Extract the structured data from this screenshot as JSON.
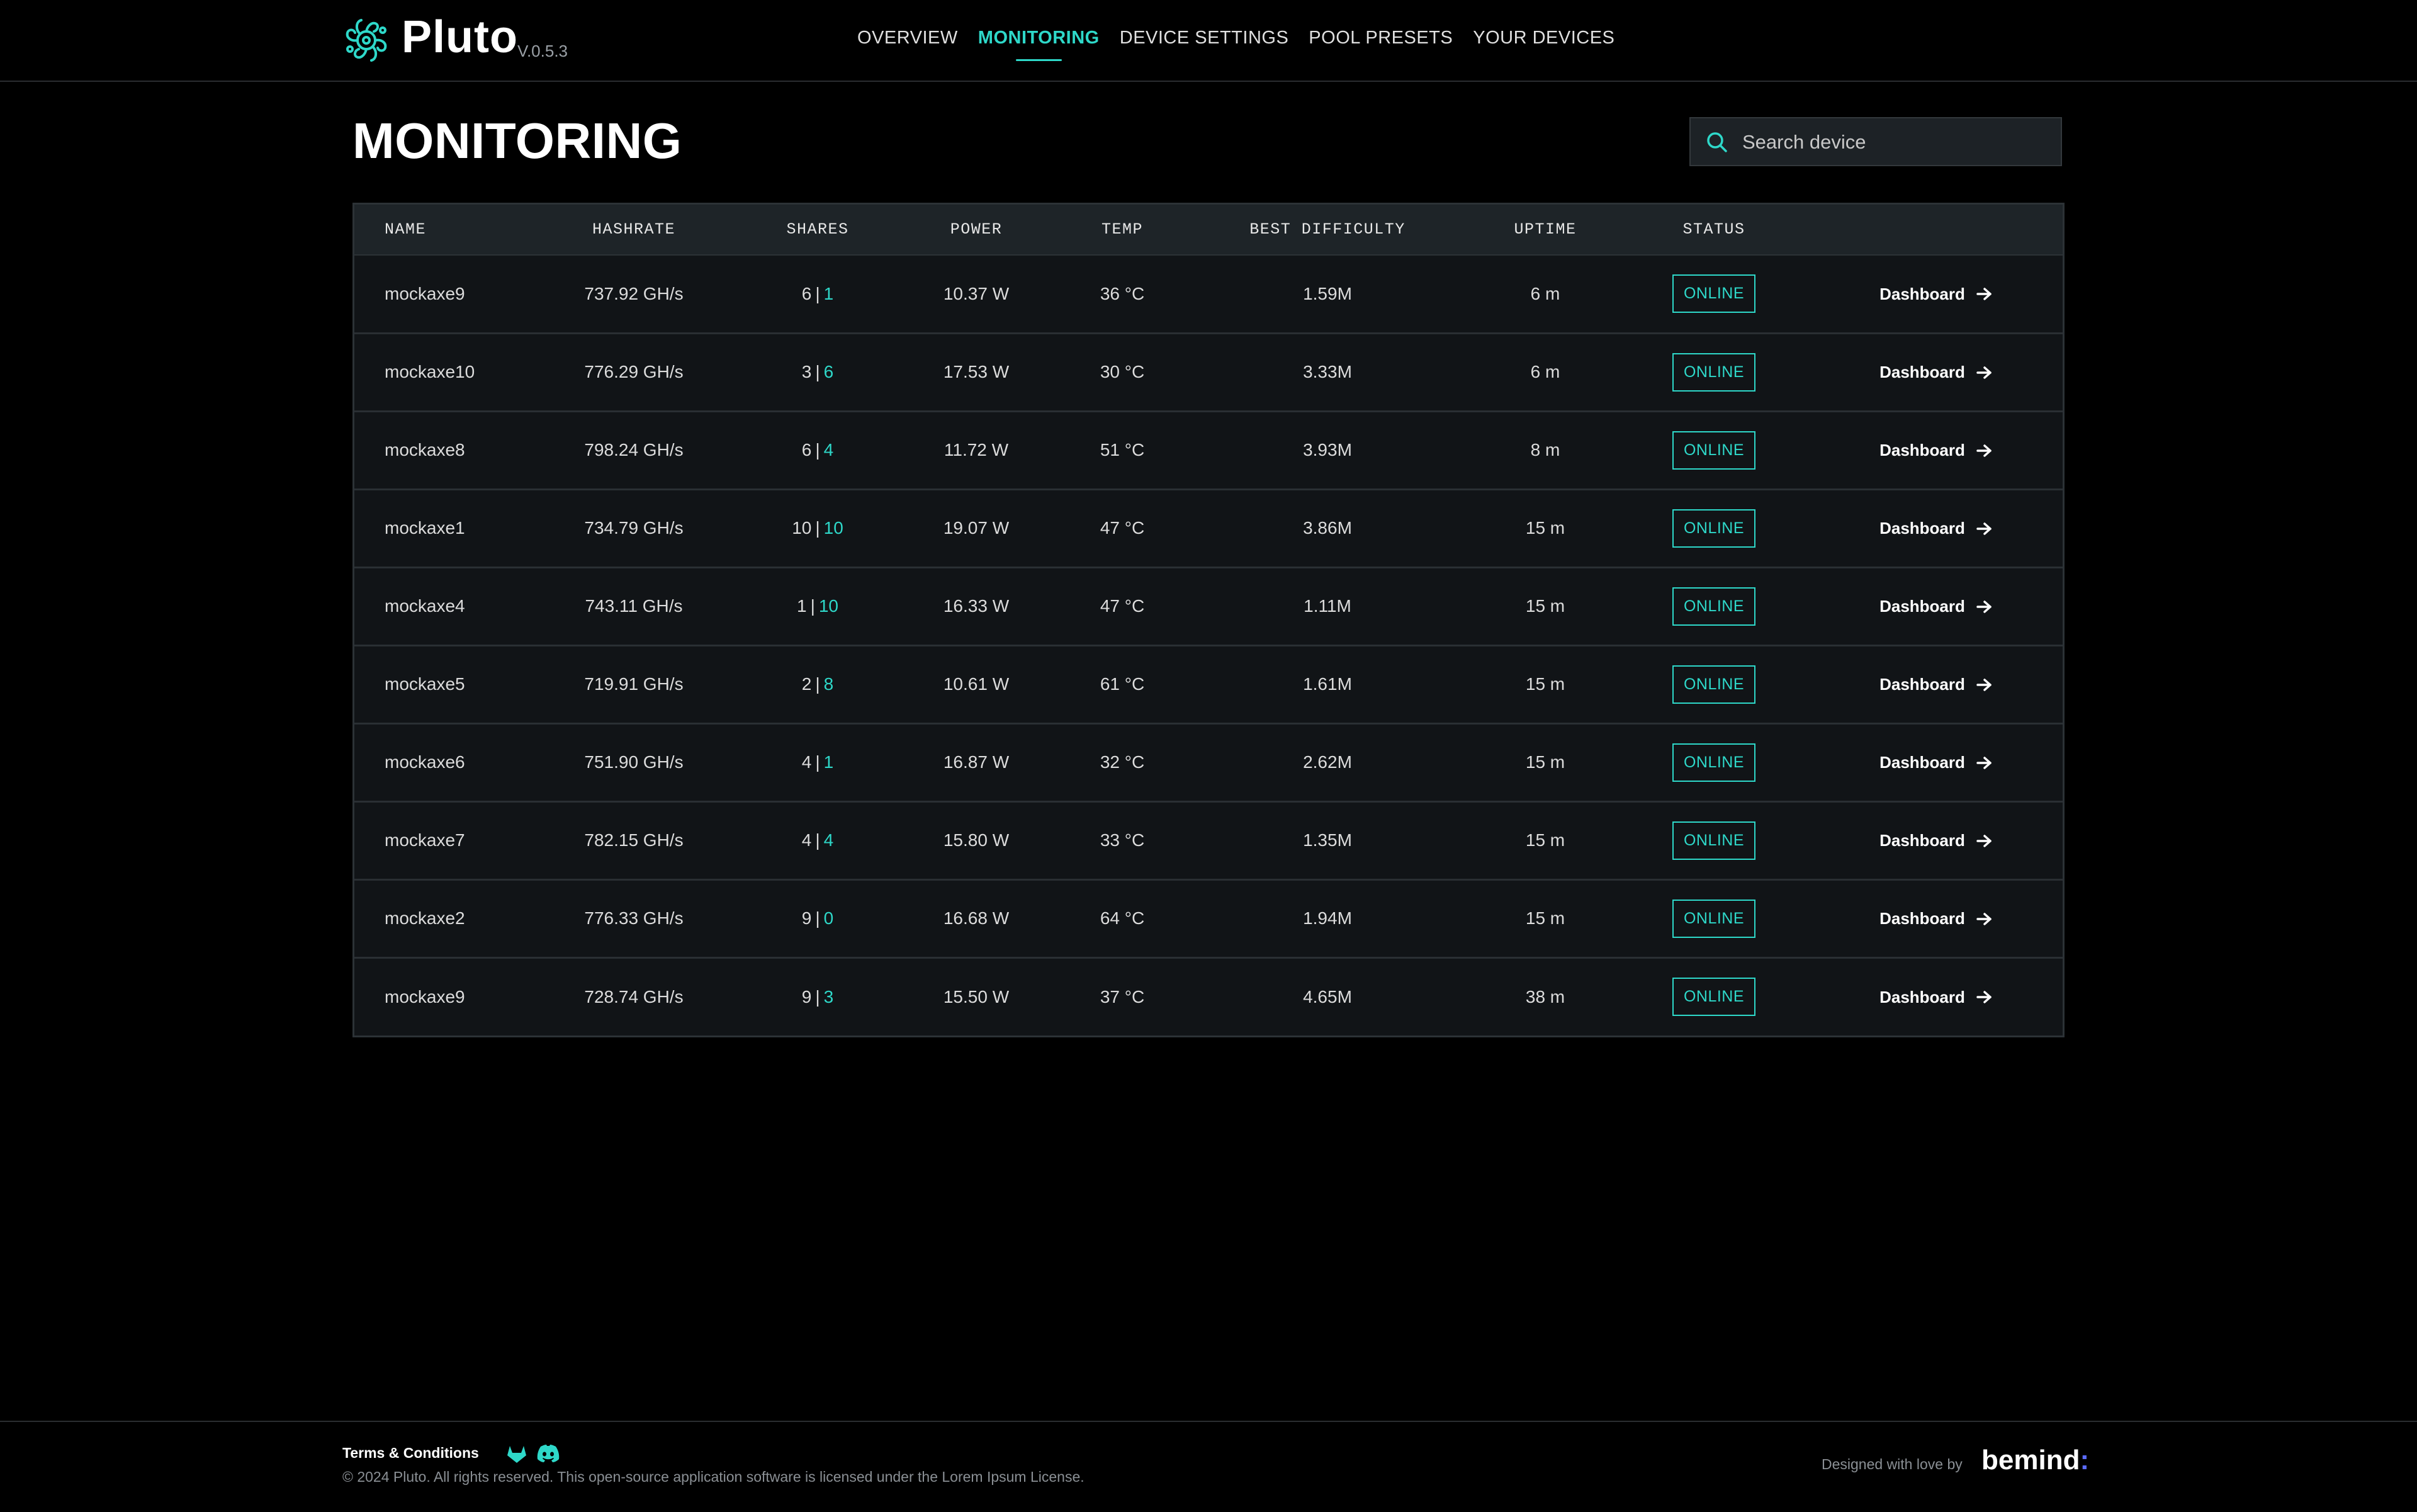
{
  "app": {
    "brand": "Pluto",
    "version": "V.0.5.3",
    "accent_color": "#2ed8c9"
  },
  "nav": {
    "items": [
      {
        "label": "OVERVIEW",
        "active": false
      },
      {
        "label": "MONITORING",
        "active": true
      },
      {
        "label": "DEVICE SETTINGS",
        "active": false
      },
      {
        "label": "POOL PRESETS",
        "active": false
      },
      {
        "label": "YOUR DEVICES",
        "active": false
      }
    ]
  },
  "page": {
    "title": "MONITORING"
  },
  "search": {
    "placeholder": "Search device",
    "value": ""
  },
  "table": {
    "headers": [
      "NAME",
      "HASHRATE",
      "SHARES",
      "POWER",
      "TEMP",
      "BEST DIFFICULTY",
      "UPTIME",
      "STATUS",
      ""
    ],
    "rows": [
      {
        "name": "mockaxe9",
        "hashrate": "737.92 GH/s",
        "shares_a": "6",
        "shares_b": "1",
        "power": "10.37 W",
        "temp": "36 °C",
        "best_difficulty": "1.59M",
        "uptime": "6 m",
        "status": "ONLINE",
        "action": "Dashboard"
      },
      {
        "name": "mockaxe10",
        "hashrate": "776.29 GH/s",
        "shares_a": "3",
        "shares_b": "6",
        "power": "17.53 W",
        "temp": "30 °C",
        "best_difficulty": "3.33M",
        "uptime": "6 m",
        "status": "ONLINE",
        "action": "Dashboard"
      },
      {
        "name": "mockaxe8",
        "hashrate": "798.24 GH/s",
        "shares_a": "6",
        "shares_b": "4",
        "power": "11.72 W",
        "temp": "51 °C",
        "best_difficulty": "3.93M",
        "uptime": "8 m",
        "status": "ONLINE",
        "action": "Dashboard"
      },
      {
        "name": "mockaxe1",
        "hashrate": "734.79 GH/s",
        "shares_a": "10",
        "shares_b": "10",
        "power": "19.07 W",
        "temp": "47 °C",
        "best_difficulty": "3.86M",
        "uptime": "15 m",
        "status": "ONLINE",
        "action": "Dashboard"
      },
      {
        "name": "mockaxe4",
        "hashrate": "743.11 GH/s",
        "shares_a": "1",
        "shares_b": "10",
        "power": "16.33 W",
        "temp": "47 °C",
        "best_difficulty": "1.11M",
        "uptime": "15 m",
        "status": "ONLINE",
        "action": "Dashboard"
      },
      {
        "name": "mockaxe5",
        "hashrate": "719.91 GH/s",
        "shares_a": "2",
        "shares_b": "8",
        "power": "10.61 W",
        "temp": "61 °C",
        "best_difficulty": "1.61M",
        "uptime": "15 m",
        "status": "ONLINE",
        "action": "Dashboard"
      },
      {
        "name": "mockaxe6",
        "hashrate": "751.90 GH/s",
        "shares_a": "4",
        "shares_b": "1",
        "power": "16.87 W",
        "temp": "32 °C",
        "best_difficulty": "2.62M",
        "uptime": "15 m",
        "status": "ONLINE",
        "action": "Dashboard"
      },
      {
        "name": "mockaxe7",
        "hashrate": "782.15 GH/s",
        "shares_a": "4",
        "shares_b": "4",
        "power": "15.80 W",
        "temp": "33 °C",
        "best_difficulty": "1.35M",
        "uptime": "15 m",
        "status": "ONLINE",
        "action": "Dashboard"
      },
      {
        "name": "mockaxe2",
        "hashrate": "776.33 GH/s",
        "shares_a": "9",
        "shares_b": "0",
        "power": "16.68 W",
        "temp": "64 °C",
        "best_difficulty": "1.94M",
        "uptime": "15 m",
        "status": "ONLINE",
        "action": "Dashboard"
      },
      {
        "name": "mockaxe9",
        "hashrate": "728.74 GH/s",
        "shares_a": "9",
        "shares_b": "3",
        "power": "15.50 W",
        "temp": "37 °C",
        "best_difficulty": "4.65M",
        "uptime": "38 m",
        "status": "ONLINE",
        "action": "Dashboard"
      }
    ]
  },
  "footer": {
    "terms": "Terms & Conditions",
    "copyright": "© 2024 Pluto. All rights reserved. This open-source application software is licensed under the Lorem Ipsum License.",
    "designed_by": "Designed with love by",
    "designer": "bemind",
    "designer_suffix": ":",
    "icons": [
      "gitlab-icon",
      "discord-icon"
    ]
  }
}
